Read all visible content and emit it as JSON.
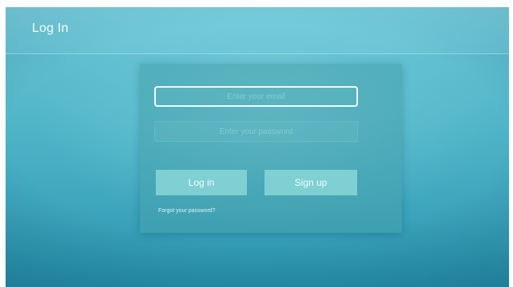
{
  "header": {
    "title": "Log In"
  },
  "form": {
    "email_placeholder": "Enter your email",
    "password_placeholder": "Enter your password",
    "login_label": "Log in",
    "signup_label": "Sign up",
    "forgot_label": "Forgot your password?"
  },
  "colors": {
    "background": "#55b8ca",
    "panel": "#46a0ac",
    "button": "#7ed0d2",
    "focus_border": "#eef9fa"
  }
}
